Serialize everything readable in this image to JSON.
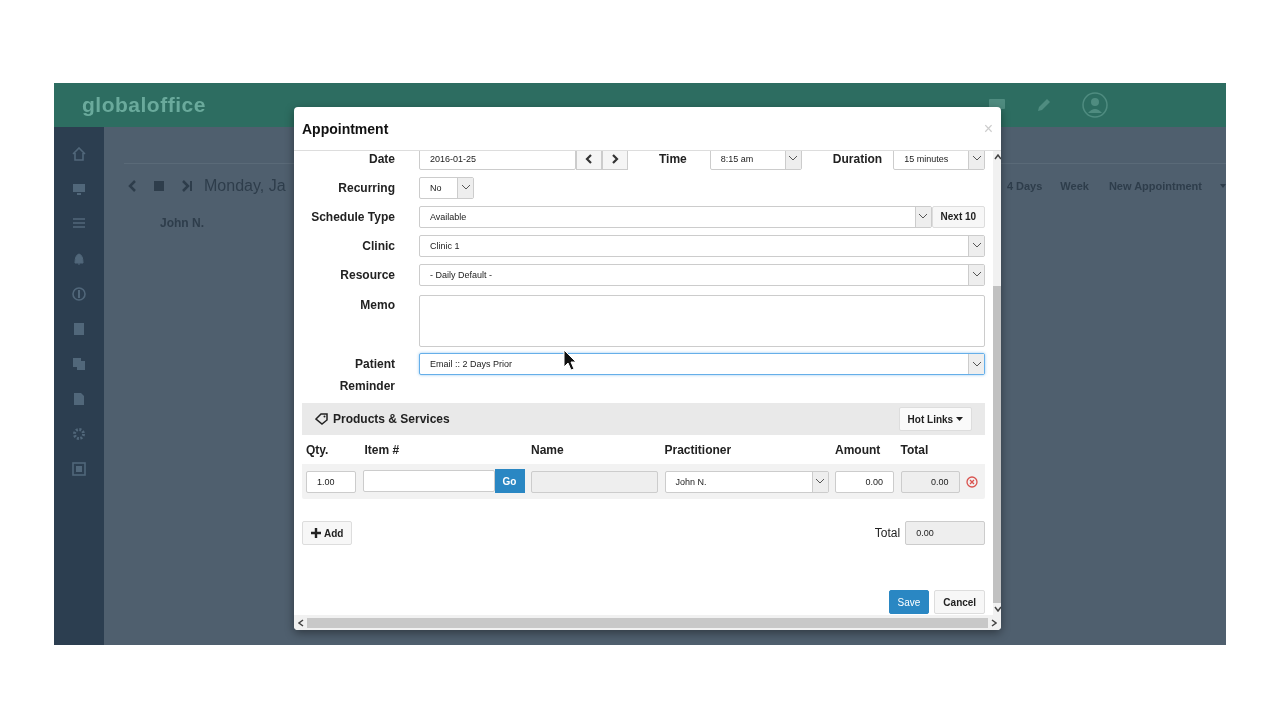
{
  "app": {
    "logo": "globaloffice",
    "date_title": "Monday, Ja",
    "provider": "John N.",
    "views": [
      "4 Days",
      "Week"
    ],
    "new_appointment": "New Appointment"
  },
  "modal": {
    "title": "Appointment",
    "close": "×",
    "date": {
      "label": "Date",
      "value": "2016-01-25"
    },
    "time": {
      "label": "Time",
      "value": "8:15 am"
    },
    "duration": {
      "label": "Duration",
      "value": "15 minutes"
    },
    "recurring": {
      "label": "Recurring",
      "value": "No"
    },
    "schedule_type": {
      "label": "Schedule Type",
      "value": "Available",
      "button": "Next 10"
    },
    "clinic": {
      "label": "Clinic",
      "value": "Clinic 1"
    },
    "resource": {
      "label": "Resource",
      "value": "- Daily Default -"
    },
    "memo": {
      "label": "Memo"
    },
    "reminder": {
      "label": "Patient Reminder",
      "value": "Email :: 2 Days Prior",
      "focused": true
    },
    "products": {
      "title": "Products & Services",
      "hot_links": "Hot Links",
      "columns": [
        "Qty.",
        "Item #",
        "Name",
        "Practitioner",
        "Amount",
        "Total"
      ],
      "rows": [
        {
          "qty": "1.00",
          "go": "Go",
          "practitioner": "John N.",
          "amount": "0.00",
          "total": "0.00"
        }
      ],
      "add": "Add",
      "total_label": "Total",
      "total": "0.00"
    },
    "buttons": {
      "save": "Save",
      "cancel": "Cancel"
    }
  }
}
